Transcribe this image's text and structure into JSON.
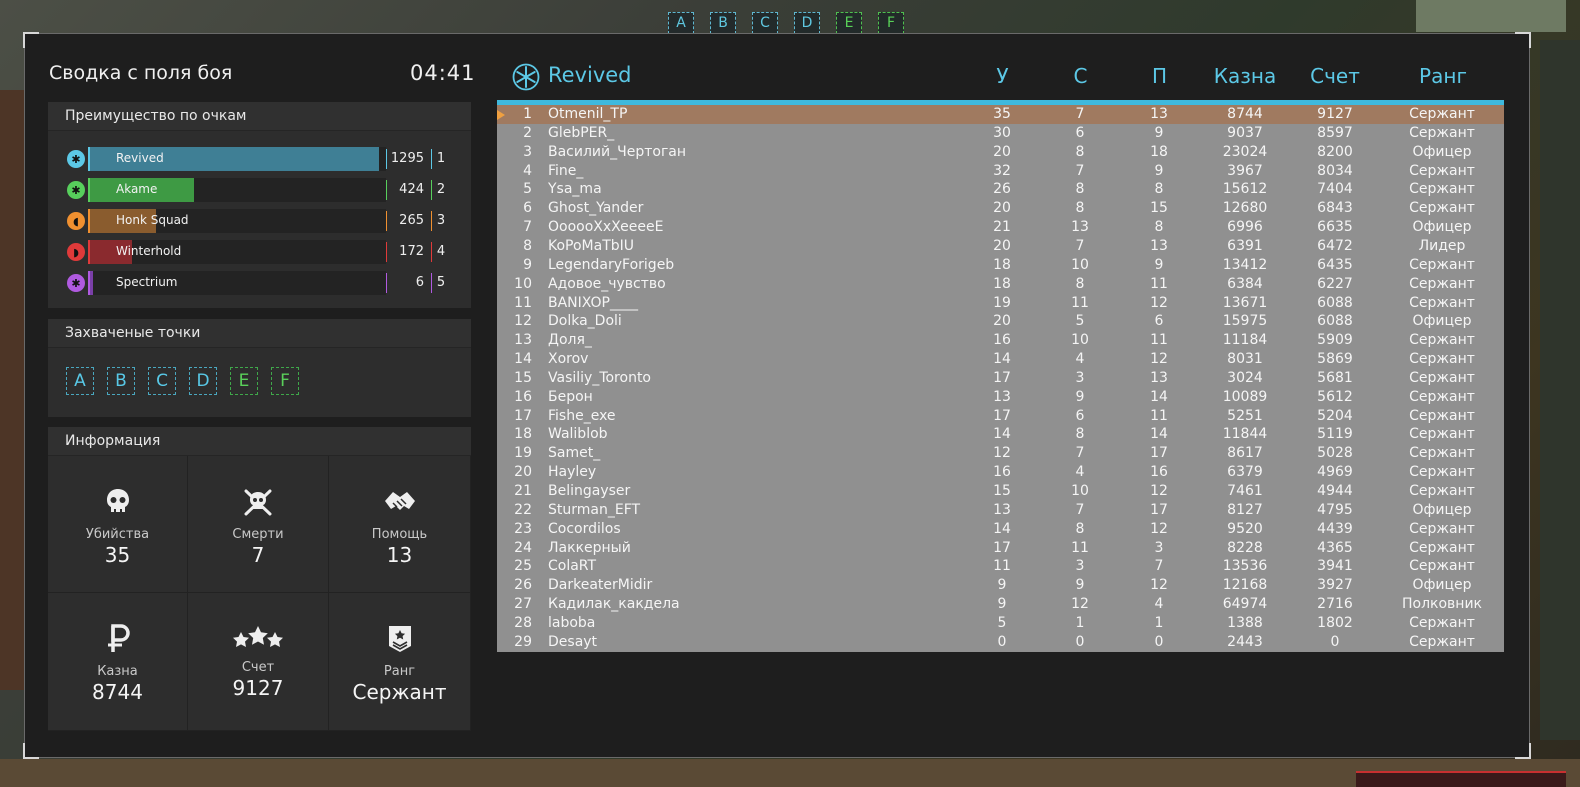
{
  "top_capture_points": [
    {
      "letter": "A",
      "owner": "blue"
    },
    {
      "letter": "B",
      "owner": "blue"
    },
    {
      "letter": "C",
      "owner": "blue"
    },
    {
      "letter": "D",
      "owner": "blue"
    },
    {
      "letter": "E",
      "owner": "green"
    },
    {
      "letter": "F",
      "owner": "green"
    }
  ],
  "summary": {
    "title": "Сводка с поля боя",
    "timer": "04:41"
  },
  "score_panel": {
    "title": "Преимущество по очкам",
    "teams": [
      {
        "name": "Revived",
        "points": "1295",
        "place": "1",
        "fill": 0.97,
        "color": "#3f7f95",
        "accent": "#5cc8e6",
        "icon": "snowflake-icon"
      },
      {
        "name": "Akame",
        "points": "424",
        "place": "2",
        "fill": 0.35,
        "color": "#3e9a44",
        "accent": "#57cf5c",
        "icon": "snowflake-icon"
      },
      {
        "name": "Honk Squad",
        "points": "265",
        "place": "3",
        "fill": 0.22,
        "color": "#8a5c2e",
        "accent": "#f09030",
        "icon": "bird-icon"
      },
      {
        "name": "Winterhold",
        "points": "172",
        "place": "4",
        "fill": 0.14,
        "color": "#8a2a2e",
        "accent": "#e03a3a",
        "icon": "dragon-icon"
      },
      {
        "name": "Spectrium",
        "points": "6",
        "place": "5",
        "fill": 0.01,
        "color": "#7a3fa8",
        "accent": "#b05ae0",
        "icon": "snowflake-icon"
      }
    ]
  },
  "captured_panel": {
    "title": "Захваченые точки",
    "points": [
      {
        "letter": "A",
        "owner": "blue"
      },
      {
        "letter": "B",
        "owner": "blue"
      },
      {
        "letter": "C",
        "owner": "blue"
      },
      {
        "letter": "D",
        "owner": "blue"
      },
      {
        "letter": "E",
        "owner": "green"
      },
      {
        "letter": "F",
        "owner": "green"
      }
    ]
  },
  "info_panel": {
    "title": "Информация",
    "stats": [
      {
        "label": "Убийства",
        "value": "35",
        "icon": "skull-icon"
      },
      {
        "label": "Смерти",
        "value": "7",
        "icon": "skull-crossbones-icon"
      },
      {
        "label": "Помощь",
        "value": "13",
        "icon": "handshake-icon"
      },
      {
        "label": "Казна",
        "value": "8744",
        "icon": "ruble-icon"
      },
      {
        "label": "Счет",
        "value": "9127",
        "icon": "stars-icon"
      },
      {
        "label": "Ранг",
        "value": "Сержант",
        "icon": "rank-badge-icon"
      }
    ]
  },
  "scoreboard": {
    "team_name": "Revived",
    "headers": {
      "kills": "У",
      "deaths": "С",
      "assists": "П",
      "cash": "Казна",
      "score": "Счет",
      "rank": "Ранг"
    },
    "rows": [
      [
        "1",
        "Otmenil_TP",
        "35",
        "7",
        "13",
        "8744",
        "9127",
        "Сержант"
      ],
      [
        "2",
        "GlebPER_",
        "30",
        "6",
        "9",
        "9037",
        "8597",
        "Сержант"
      ],
      [
        "3",
        "Василий_Чертоган",
        "20",
        "8",
        "18",
        "23024",
        "8200",
        "Офицер"
      ],
      [
        "4",
        "Fine_",
        "32",
        "7",
        "9",
        "3967",
        "8034",
        "Сержант"
      ],
      [
        "5",
        "Ysa_ma",
        "26",
        "8",
        "8",
        "15612",
        "7404",
        "Сержант"
      ],
      [
        "6",
        "Ghost_Yander",
        "20",
        "8",
        "15",
        "12680",
        "6843",
        "Сержант"
      ],
      [
        "7",
        "OooooXxXeeeeE",
        "21",
        "13",
        "8",
        "6996",
        "6635",
        "Офицер"
      ],
      [
        "8",
        "KoPoMaTbIU",
        "20",
        "7",
        "13",
        "6391",
        "6472",
        "Лидер"
      ],
      [
        "9",
        "LegendaryForigeb",
        "18",
        "10",
        "9",
        "13412",
        "6435",
        "Сержант"
      ],
      [
        "10",
        "Адовое_чувство",
        "18",
        "8",
        "11",
        "6384",
        "6227",
        "Сержант"
      ],
      [
        "11",
        "BANIXOP____",
        "19",
        "11",
        "12",
        "13671",
        "6088",
        "Сержант"
      ],
      [
        "12",
        "Dolka_Doli",
        "20",
        "5",
        "6",
        "15975",
        "6088",
        "Офицер"
      ],
      [
        "13",
        "Доля_",
        "16",
        "10",
        "11",
        "11184",
        "5909",
        "Сержант"
      ],
      [
        "14",
        "Xorov",
        "14",
        "4",
        "12",
        "8031",
        "5869",
        "Сержант"
      ],
      [
        "15",
        "Vasiliy_Toronto",
        "17",
        "3",
        "13",
        "3024",
        "5681",
        "Сержант"
      ],
      [
        "16",
        "Берон",
        "13",
        "9",
        "14",
        "10089",
        "5612",
        "Сержант"
      ],
      [
        "17",
        "Fishe_exe",
        "17",
        "6",
        "11",
        "5251",
        "5204",
        "Сержант"
      ],
      [
        "18",
        "Waliblob",
        "14",
        "8",
        "14",
        "11844",
        "5119",
        "Сержант"
      ],
      [
        "19",
        "Samet_",
        "12",
        "7",
        "17",
        "8617",
        "5028",
        "Сержант"
      ],
      [
        "20",
        "Hayley",
        "16",
        "4",
        "16",
        "6379",
        "4969",
        "Сержант"
      ],
      [
        "21",
        "Belingayser",
        "15",
        "10",
        "12",
        "7461",
        "4944",
        "Сержант"
      ],
      [
        "22",
        "Sturman_EFT",
        "13",
        "7",
        "17",
        "8127",
        "4795",
        "Офицер"
      ],
      [
        "23",
        "Cocordilos",
        "14",
        "8",
        "12",
        "9520",
        "4439",
        "Сержант"
      ],
      [
        "24",
        "Лаккерный",
        "17",
        "11",
        "3",
        "8228",
        "4365",
        "Сержант"
      ],
      [
        "25",
        "ColaRT",
        "11",
        "3",
        "7",
        "13536",
        "3941",
        "Сержант"
      ],
      [
        "26",
        "DarkeaterMidir",
        "9",
        "9",
        "12",
        "12168",
        "3927",
        "Офицер"
      ],
      [
        "27",
        "Кадилак_какдела",
        "9",
        "12",
        "4",
        "64974",
        "2716",
        "Полковник"
      ],
      [
        "28",
        "laboba",
        "5",
        "1",
        "1",
        "1388",
        "1802",
        "Сержант"
      ],
      [
        "29",
        "Desayt",
        "0",
        "0",
        "0",
        "2443",
        "0",
        "Сержант"
      ]
    ],
    "highlighted_row": 0
  }
}
